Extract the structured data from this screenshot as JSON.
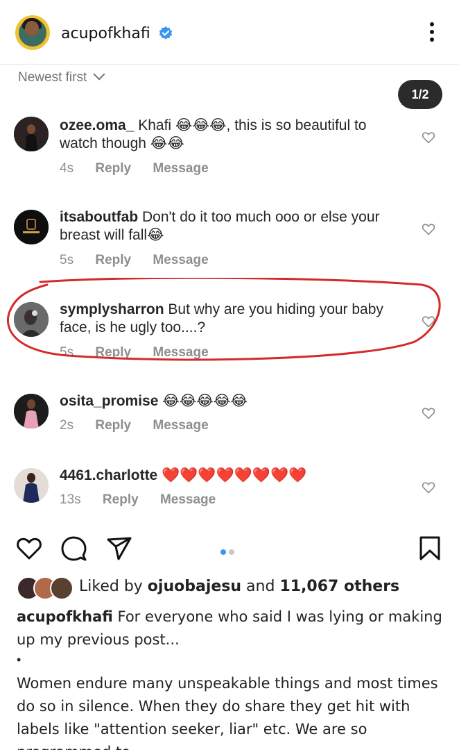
{
  "header": {
    "username": "acupofkhafi",
    "verified": true,
    "more_icon": "more-vertical-icon"
  },
  "sort": {
    "label": "Newest first"
  },
  "pager": {
    "label": "1/2"
  },
  "comments": [
    {
      "user": "ozee.oma_",
      "text": " Khafi 😂😂😂, this is so beautiful to watch though 😂😂",
      "time": "4s",
      "reply": "Reply",
      "message": "Message"
    },
    {
      "user": "itsaboutfab",
      "text": " Don't do it too much ooo or else your breast will fall😂",
      "time": "5s",
      "reply": "Reply",
      "message": "Message"
    },
    {
      "user": "symplysharron",
      "text": " But why are you hiding your baby face, is he ugly too....?",
      "time": "5s",
      "reply": "Reply",
      "message": "Message"
    },
    {
      "user": "osita_promise",
      "text": " 😂😂😂😂😂",
      "time": "2s",
      "reply": "Reply",
      "message": "Message"
    },
    {
      "user": "4461.charlotte",
      "text": " ❤️❤️❤️❤️❤️❤️❤️❤️",
      "time": "13s",
      "reply": "Reply",
      "message": "Message"
    }
  ],
  "actions": {
    "like_icon": "heart-icon",
    "comment_icon": "comment-icon",
    "share_icon": "send-icon",
    "save_icon": "bookmark-icon",
    "carousel_active_color": "#3897f0",
    "carousel_inactive_color": "#c7c7c7"
  },
  "likes": {
    "prefix": "Liked by ",
    "user": "ojuobajesu",
    "middle": " and ",
    "count": "11,067 others"
  },
  "caption": {
    "user": "acupofkhafi",
    "text": " For everyone who said I was lying or making up my previous post...",
    "bullet": "•",
    "body": "Women endure many unspeakable things and most times do so in silence. When they do share they get hit with labels like \"attention seeker, liar\" etc. We are so programmed to"
  },
  "colors": {
    "verified": "#3897f0",
    "highlight": "#d42a2a",
    "muted": "#8e8e8e"
  }
}
